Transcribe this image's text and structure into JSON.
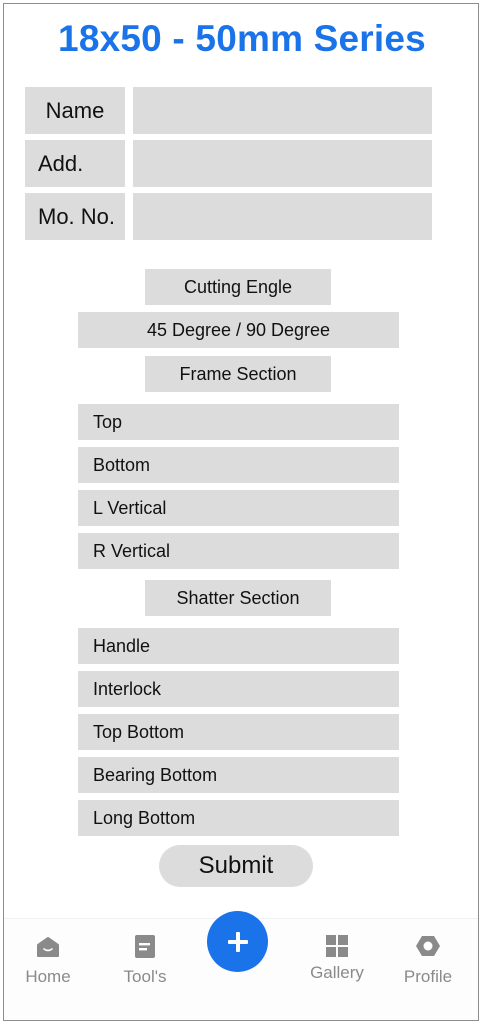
{
  "title": "18x50 - 50mm Series",
  "form": {
    "name_label": "Name",
    "name_value": "",
    "address_label": "Add.",
    "address_value": "",
    "mobile_label": "Mo. No.",
    "mobile_value": ""
  },
  "cutting": {
    "header": "Cutting Engle",
    "option": "45 Degree / 90 Degree"
  },
  "frame_section": {
    "header": "Frame Section",
    "items": [
      "Top",
      "Bottom",
      "L Vertical",
      "R Vertical"
    ]
  },
  "shatter_section": {
    "header": "Shatter Section",
    "items": [
      "Handle",
      "Interlock",
      "Top Bottom",
      "Bearing Bottom",
      "Long Bottom"
    ]
  },
  "submit_label": "Submit",
  "bottom_nav": {
    "items": [
      {
        "label": "Home",
        "icon": "home-icon"
      },
      {
        "label": "Tool's",
        "icon": "document-icon"
      },
      {
        "label": "Gallery",
        "icon": "grid-icon"
      },
      {
        "label": "Profile",
        "icon": "hexagon-icon"
      }
    ],
    "fab_icon": "plus-icon"
  },
  "colors": {
    "accent": "#1a73e8",
    "field_bg": "#dcdcdc",
    "nav_icon": "#8a8a8a"
  }
}
